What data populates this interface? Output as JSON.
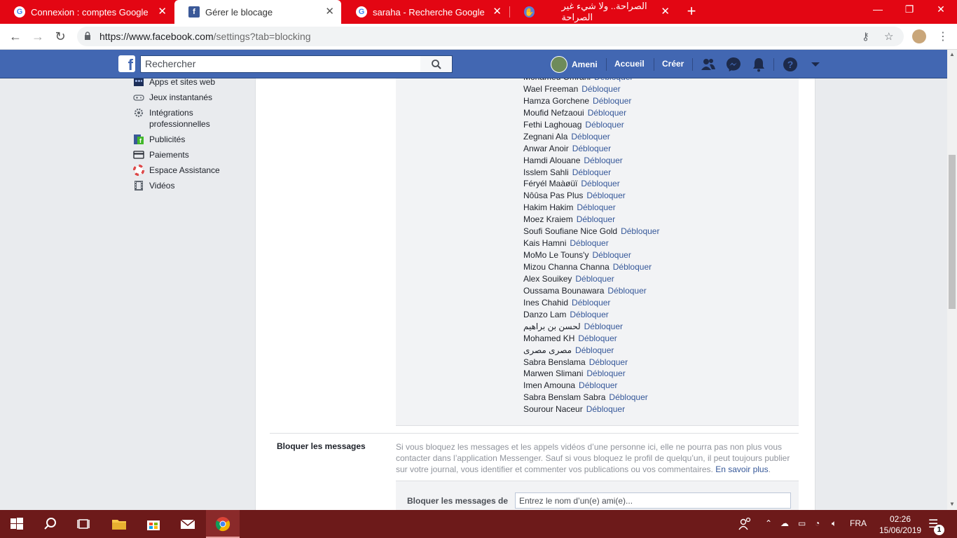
{
  "browser": {
    "tabs": [
      {
        "title": "Connexion : comptes Google",
        "icon": "google-icon",
        "active": false
      },
      {
        "title": "Gérer le blocage",
        "icon": "facebook-icon",
        "active": true
      },
      {
        "title": "saraha - Recherche Google",
        "icon": "google-icon",
        "active": false
      },
      {
        "title": "الصراحة.. ولا شيء غير الصراحة",
        "icon": "sarahah-icon",
        "active": false
      }
    ],
    "close_glyph": "✕",
    "new_tab_glyph": "+",
    "url_host": "https://www.facebook.com",
    "url_path": "/settings?tab=blocking"
  },
  "fb": {
    "search_placeholder": "Rechercher",
    "user_name": "Ameni",
    "nav_home": "Accueil",
    "nav_create": "Créer"
  },
  "sidebar": {
    "items": [
      {
        "label": "Apps et sites web",
        "icon": "apps-icon"
      },
      {
        "label": "Jeux instantanés",
        "icon": "gamepad-icon"
      },
      {
        "label": "Intégrations professionnelles",
        "icon": "gear-icon"
      },
      {
        "label": "Publicités",
        "icon": "ads-icon"
      },
      {
        "label": "Paiements",
        "icon": "credit-card-icon"
      },
      {
        "label": "Espace Assistance",
        "icon": "lifebuoy-icon"
      },
      {
        "label": "Vidéos",
        "icon": "film-icon"
      }
    ]
  },
  "blocked": {
    "unblock_label": "Débloquer",
    "people": [
      "Mohamed Omrani",
      "Wael Freeman",
      "Hamza Gorchene",
      "Moufid Nefzaoui",
      "Fethi Laghouag",
      "Zegnani Ala",
      "Anwar Anoir",
      "Hamdi Alouane",
      "Isslem Sahli",
      "Féryél Maàøüï",
      "Nôûsa Pas Plus",
      "Hakim Hakim",
      "Moez Kraiem",
      "Soufi Soufiane Nice Gold",
      "Kais Hamni",
      "MoMo Le Touns'y",
      "Mizou Channa Channa",
      "Alex Souikey",
      "Oussama Bounawara",
      "Ines Chahid",
      "Danzo Lam",
      "لحسن بن براهيم",
      "Mohamed KH",
      "مصرى مصرى",
      "Sabra Benslama",
      "Marwen Slimani",
      "Imen Amouna",
      "Sabra Benslam Sabra",
      "Sourour Naceur"
    ]
  },
  "block_messages": {
    "title": "Bloquer les messages",
    "description": "Si vous bloquez les messages et les appels vidéos d’une personne ici, elle ne pourra pas non plus vous contacter dans l’application Messenger. Sauf si vous bloquez le profil de quelqu’un, il peut toujours publier sur votre journal, vous identifier et commenter vos publications ou vos commentaires.",
    "learn_more": "En savoir plus",
    "field_label": "Bloquer les messages de",
    "field_placeholder": "Entrez le nom d’un(e) ami(e)..."
  },
  "taskbar": {
    "language": "FRA",
    "time": "02:26",
    "date": "15/06/2019",
    "notification_count": "1"
  },
  "colors": {
    "chrome_red": "#e30613",
    "facebook_blue": "#4267b2",
    "link_blue": "#365899",
    "taskbar": "#6d1a1a"
  }
}
